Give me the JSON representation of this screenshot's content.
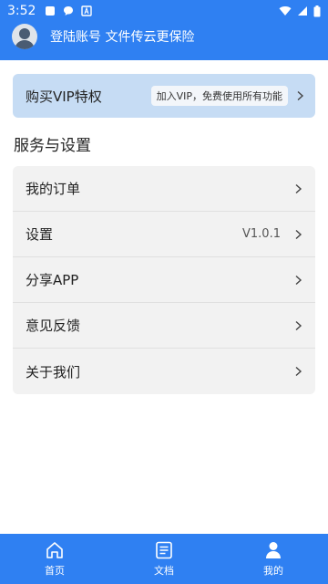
{
  "status_bar": {
    "time": "3:52"
  },
  "header": {
    "account_text": "登陆账号 文件传云更保险"
  },
  "vip": {
    "title": "购买VIP特权",
    "badge": "加入VIP，免费使用所有功能"
  },
  "section": {
    "title": "服务与设置"
  },
  "menu": {
    "items": [
      {
        "label": "我的订单",
        "value": ""
      },
      {
        "label": "设置",
        "value": "V1.0.1"
      },
      {
        "label": "分享APP",
        "value": ""
      },
      {
        "label": "意见反馈",
        "value": ""
      },
      {
        "label": "关于我们",
        "value": ""
      }
    ]
  },
  "tabbar": {
    "tabs": [
      {
        "label": "首页",
        "icon": "home-icon"
      },
      {
        "label": "文档",
        "icon": "document-icon"
      },
      {
        "label": "我的",
        "icon": "person-icon"
      }
    ]
  },
  "colors": {
    "primary": "#2f80f2",
    "vip_bg": "#c6dcf4",
    "list_bg": "#f2f2f2"
  }
}
